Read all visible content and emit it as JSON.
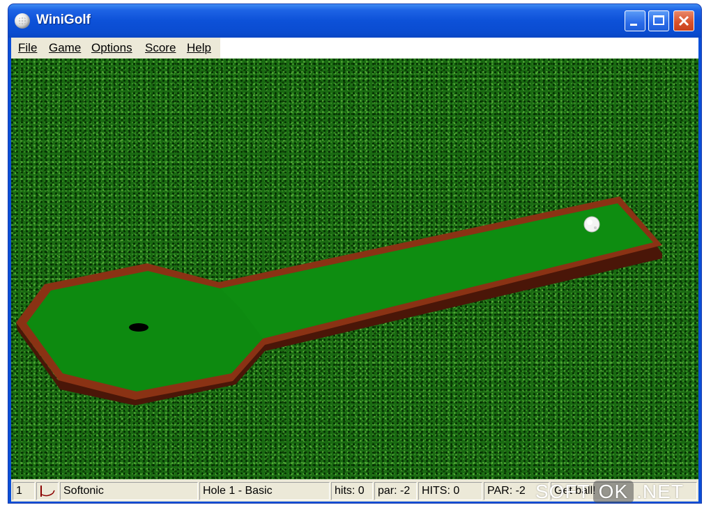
{
  "window": {
    "title": "WiniGolf"
  },
  "menu": {
    "items": [
      {
        "label": "File"
      },
      {
        "label": "Game"
      },
      {
        "label": "Options"
      },
      {
        "label": "Score"
      },
      {
        "label": "Help"
      }
    ]
  },
  "status": {
    "player_number": "1",
    "player_name": "Softonic",
    "hole": "Hole 1 - Basic",
    "hits": "hits: 0",
    "par": "par: -2",
    "total_hits": "HITS: 0",
    "total_par": "PAR: -2",
    "message": "Get ball!"
  },
  "watermark": {
    "left": "SOFT",
    "middle": "OK",
    "right": ".NET"
  },
  "colors": {
    "title_bar": "#0a4fd8",
    "fairway": "#0d8a10",
    "border_wood": "#7a2c10",
    "grass": "#1a6a12"
  },
  "icons": {
    "app": "golf-ball-icon",
    "status": "flag-icon",
    "ball": "golf-ball"
  }
}
